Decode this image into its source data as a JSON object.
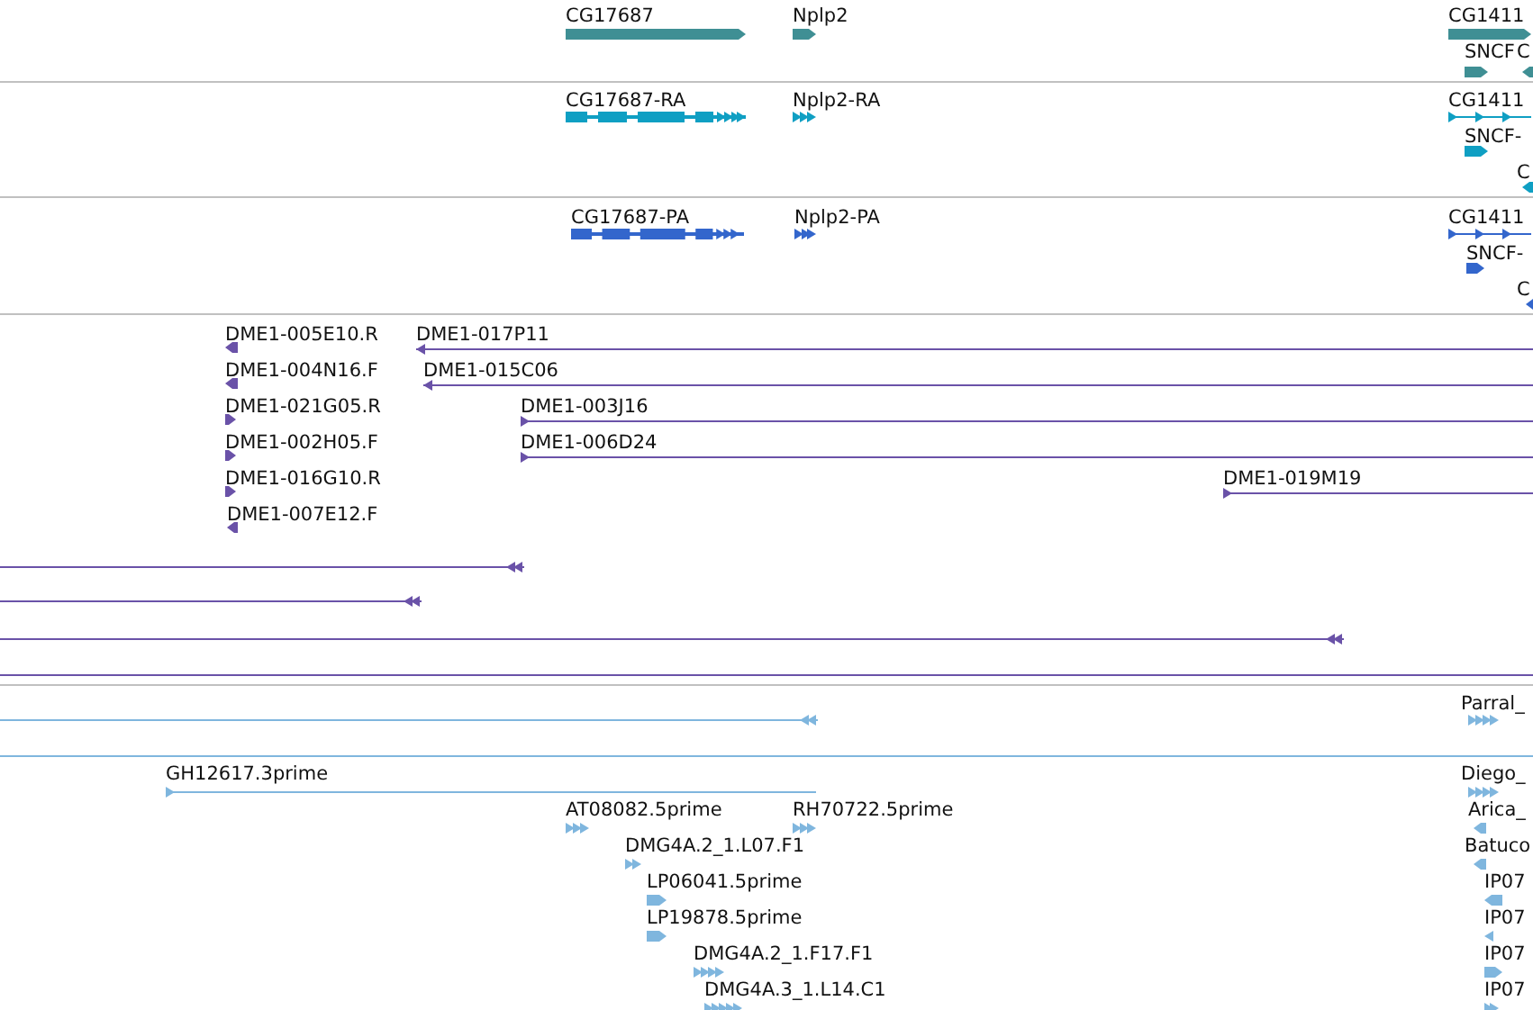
{
  "tracks": [
    {
      "color": "#3f8f94",
      "features": [
        {
          "label": "CG17687",
          "kind": "bar",
          "reverse": false
        },
        {
          "label": "Nplp2",
          "kind": "bar",
          "reverse": false
        },
        {
          "label": "CG1411",
          "kind": "bar",
          "reverse": false
        },
        {
          "label": "SNCF",
          "kind": "bar",
          "reverse": false
        },
        {
          "label": "C",
          "kind": "bar",
          "reverse": true
        }
      ]
    },
    {
      "color": "#0f9fc3",
      "features": [
        {
          "label": "CG17687-RA",
          "kind": "exons",
          "reverse": false
        },
        {
          "label": "Nplp2-RA",
          "kind": "arrows",
          "reverse": false
        },
        {
          "label": "CG1411",
          "kind": "spliced",
          "reverse": false
        },
        {
          "label": "SNCF-",
          "kind": "bar",
          "reverse": false
        },
        {
          "label": "C",
          "kind": "bar",
          "reverse": true
        }
      ]
    },
    {
      "color": "#3366cc",
      "features": [
        {
          "label": "CG17687-PA",
          "kind": "exons",
          "reverse": false
        },
        {
          "label": "Nplp2-PA",
          "kind": "arrows",
          "reverse": false
        },
        {
          "label": "CG1411",
          "kind": "spliced",
          "reverse": false
        },
        {
          "label": "SNCF-",
          "kind": "bar",
          "reverse": false
        },
        {
          "label": "C",
          "kind": "bar",
          "reverse": true
        }
      ]
    },
    {
      "color": "#6a52a8",
      "features": [
        {
          "label": "DME1-005E10.R",
          "kind": "bar",
          "reverse": true
        },
        {
          "label": "DME1-017P11",
          "kind": "line",
          "reverse": true
        },
        {
          "label": "DME1-004N16.F",
          "kind": "bar",
          "reverse": true
        },
        {
          "label": "DME1-015C06",
          "kind": "line",
          "reverse": true
        },
        {
          "label": "DME1-021G05.R",
          "kind": "bar",
          "reverse": false
        },
        {
          "label": "DME1-003J16",
          "kind": "line",
          "reverse": false
        },
        {
          "label": "DME1-002H05.F",
          "kind": "bar",
          "reverse": false
        },
        {
          "label": "DME1-006D24",
          "kind": "line",
          "reverse": false
        },
        {
          "label": "DME1-016G10.R",
          "kind": "bar",
          "reverse": false
        },
        {
          "label": "DME1-019M19",
          "kind": "line",
          "reverse": false
        },
        {
          "label": "DME1-007E12.F",
          "kind": "bar",
          "reverse": true
        },
        {
          "kind": "line",
          "reverse": true
        },
        {
          "kind": "line",
          "reverse": true
        },
        {
          "kind": "line",
          "reverse": true
        },
        {
          "kind": "line"
        }
      ]
    },
    {
      "color": "#7fb6de",
      "features": [
        {
          "kind": "line",
          "reverse": true
        },
        {
          "label": "Parral_",
          "kind": "arrows",
          "reverse": false
        },
        {
          "kind": "line"
        }
      ]
    },
    {
      "color": "#7fb6de",
      "features": [
        {
          "label": "GH12617.3prime",
          "kind": "line",
          "reverse": false
        },
        {
          "label": "AT08082.5prime",
          "kind": "arrows",
          "reverse": false
        },
        {
          "label": "RH70722.5prime",
          "kind": "arrows",
          "reverse": false
        },
        {
          "label": "DMG4A.2_1.L07.F1",
          "kind": "arrows",
          "reverse": false
        },
        {
          "label": "LP06041.5prime",
          "kind": "bar",
          "reverse": false
        },
        {
          "label": "LP19878.5prime",
          "kind": "bar",
          "reverse": false
        },
        {
          "label": "DMG4A.2_1.F17.F1",
          "kind": "arrows",
          "reverse": false
        },
        {
          "label": "DMG4A.3_1.L14.C1",
          "kind": "arrows",
          "reverse": false
        },
        {
          "label": "Diego_",
          "kind": "arrows",
          "reverse": false
        },
        {
          "label": "Arica_",
          "kind": "bar",
          "reverse": true
        },
        {
          "label": "Batuco",
          "kind": "bar",
          "reverse": true
        },
        {
          "label": "IP07",
          "kind": "bar",
          "reverse": true
        },
        {
          "label": "IP07",
          "kind": "arrows",
          "reverse": true
        },
        {
          "label": "IP07",
          "kind": "bar",
          "reverse": false
        },
        {
          "label": "IP07",
          "kind": "arrows",
          "reverse": false
        }
      ]
    }
  ]
}
